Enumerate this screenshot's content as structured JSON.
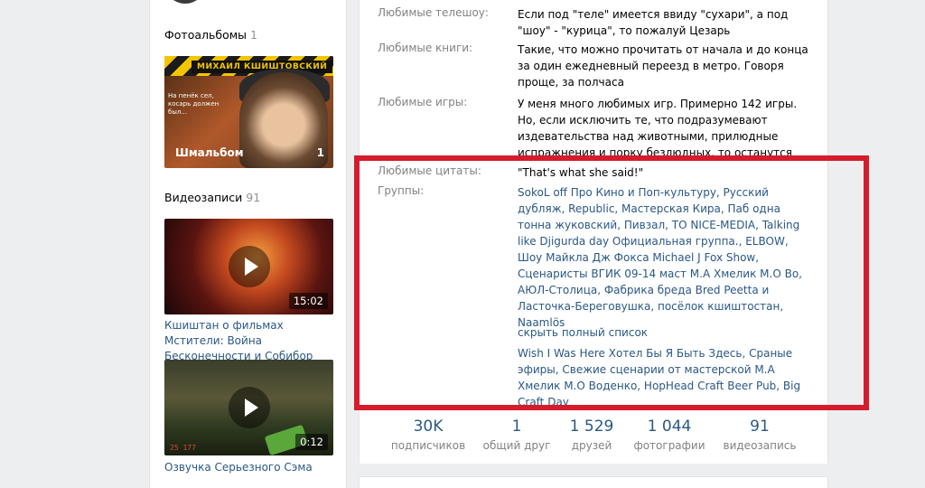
{
  "sidebar": {
    "photo_albums": {
      "title": "Фотоальбомы",
      "count": "1"
    },
    "album": {
      "banner": "МИХАИЛ КШИШТОВСКИЙ",
      "small_text": "На пенёк сел, косарь должен был...",
      "caption": "Шмальбом",
      "count": "1"
    },
    "videos": {
      "title": "Видеозаписи",
      "count": "91"
    },
    "video_items": [
      {
        "title": "Кшиштан о фильмах Мстители: Война Бесконечности и Собибор",
        "duration": "15:02"
      },
      {
        "title": "Озвучка Серьезного Сэма",
        "duration": "0:12",
        "hud": "25   177"
      }
    ]
  },
  "info": {
    "rows": [
      {
        "label": "Любимые телешоу:",
        "value": "Если под \"теле\" имеется ввиду \"сухари\", а под \"шоу\" - \"курица\", то пожалуй Цезарь"
      },
      {
        "label": "Любимые книги:",
        "value": "Такие, что можно прочитать от начала и до конца за один ежедневный переезд в метро. Говоря проще, за полчаса"
      },
      {
        "label": "Любимые игры:",
        "value": "У меня много любимых игр. Примерно 142 игры. Но, если исключить те, что подразумевают издевательства над животными, прилюдные испражнения и порку безлюдных, то останутся крысиные бега и салки"
      },
      {
        "label": "Любимые цитаты:",
        "value": "\"That's what she said!\""
      },
      {
        "label": "Группы:",
        "value": "SokoL off Про Кино и Поп-культуру, Русский дубляж, Republic, Мастерская Кира, Паб одна тонна жуковский, Пивзал, TO NICE-MEDIA, Talking like Djigurda day Официальная группа., ELBOW, Шоу Майкла Дж Фокса Michael J Fox Show, Сценаристы ВГИК 09-14 маст М.А Хмелик М.О Во, АЮЛ-Столица, Фабрика бреда Bred Peetta и Ласточка-Береговушка, посёлок кшиштостан, Naamlös"
      }
    ],
    "hide_list": "скрыть полный список",
    "extra_groups": "Wish I Was Here Хотел Бы Я Быть Здесь, Сраные эфиры, Свежие сценарии от мастерской М.А Хмелик М.О Воденко, HopHead Craft Beer Pub, Big Craft Day"
  },
  "counters": [
    {
      "value": "30K",
      "label": "подписчиков"
    },
    {
      "value": "1",
      "label": "общий друг"
    },
    {
      "value": "1 529",
      "label": "друзей"
    },
    {
      "value": "1 044",
      "label": "фотографии"
    },
    {
      "value": "91",
      "label": "видеозапись"
    }
  ],
  "colors": {
    "link": "#2a5885",
    "label": "#828282",
    "highlight": "#d51c2c",
    "background": "#edeef0"
  }
}
